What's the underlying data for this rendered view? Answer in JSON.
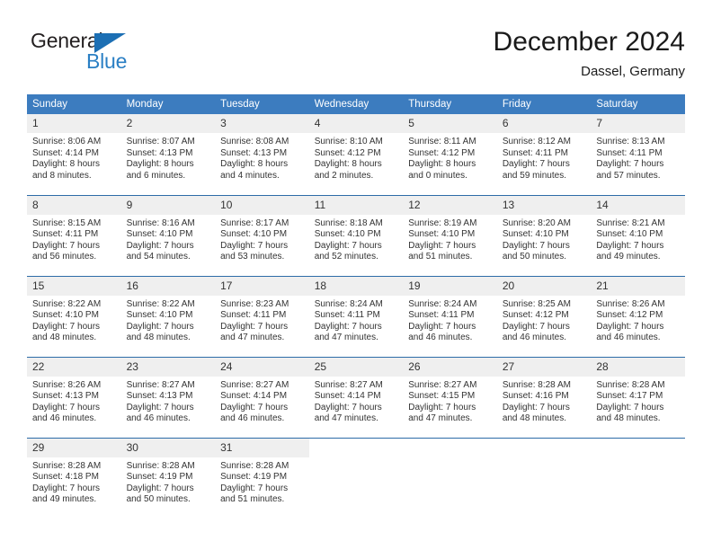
{
  "logo": {
    "word1": "General",
    "word2": "Blue",
    "triangle_color": "#1c6fb4",
    "word2_color": "#2a7fc4"
  },
  "header": {
    "title": "December 2024",
    "subtitle": "Dassel, Germany"
  },
  "theme": {
    "header_blue": "#3c7cbf",
    "row_divider_blue": "#2d6ca8",
    "daynum_band": "#efefef",
    "text": "#333333"
  },
  "calendar": {
    "weekday_headers": [
      "Sunday",
      "Monday",
      "Tuesday",
      "Wednesday",
      "Thursday",
      "Friday",
      "Saturday"
    ],
    "weeks": [
      [
        {
          "day": "1",
          "sunrise": "Sunrise: 8:06 AM",
          "sunset": "Sunset: 4:14 PM",
          "daylight1": "Daylight: 8 hours",
          "daylight2": "and 8 minutes."
        },
        {
          "day": "2",
          "sunrise": "Sunrise: 8:07 AM",
          "sunset": "Sunset: 4:13 PM",
          "daylight1": "Daylight: 8 hours",
          "daylight2": "and 6 minutes."
        },
        {
          "day": "3",
          "sunrise": "Sunrise: 8:08 AM",
          "sunset": "Sunset: 4:13 PM",
          "daylight1": "Daylight: 8 hours",
          "daylight2": "and 4 minutes."
        },
        {
          "day": "4",
          "sunrise": "Sunrise: 8:10 AM",
          "sunset": "Sunset: 4:12 PM",
          "daylight1": "Daylight: 8 hours",
          "daylight2": "and 2 minutes."
        },
        {
          "day": "5",
          "sunrise": "Sunrise: 8:11 AM",
          "sunset": "Sunset: 4:12 PM",
          "daylight1": "Daylight: 8 hours",
          "daylight2": "and 0 minutes."
        },
        {
          "day": "6",
          "sunrise": "Sunrise: 8:12 AM",
          "sunset": "Sunset: 4:11 PM",
          "daylight1": "Daylight: 7 hours",
          "daylight2": "and 59 minutes."
        },
        {
          "day": "7",
          "sunrise": "Sunrise: 8:13 AM",
          "sunset": "Sunset: 4:11 PM",
          "daylight1": "Daylight: 7 hours",
          "daylight2": "and 57 minutes."
        }
      ],
      [
        {
          "day": "8",
          "sunrise": "Sunrise: 8:15 AM",
          "sunset": "Sunset: 4:11 PM",
          "daylight1": "Daylight: 7 hours",
          "daylight2": "and 56 minutes."
        },
        {
          "day": "9",
          "sunrise": "Sunrise: 8:16 AM",
          "sunset": "Sunset: 4:10 PM",
          "daylight1": "Daylight: 7 hours",
          "daylight2": "and 54 minutes."
        },
        {
          "day": "10",
          "sunrise": "Sunrise: 8:17 AM",
          "sunset": "Sunset: 4:10 PM",
          "daylight1": "Daylight: 7 hours",
          "daylight2": "and 53 minutes."
        },
        {
          "day": "11",
          "sunrise": "Sunrise: 8:18 AM",
          "sunset": "Sunset: 4:10 PM",
          "daylight1": "Daylight: 7 hours",
          "daylight2": "and 52 minutes."
        },
        {
          "day": "12",
          "sunrise": "Sunrise: 8:19 AM",
          "sunset": "Sunset: 4:10 PM",
          "daylight1": "Daylight: 7 hours",
          "daylight2": "and 51 minutes."
        },
        {
          "day": "13",
          "sunrise": "Sunrise: 8:20 AM",
          "sunset": "Sunset: 4:10 PM",
          "daylight1": "Daylight: 7 hours",
          "daylight2": "and 50 minutes."
        },
        {
          "day": "14",
          "sunrise": "Sunrise: 8:21 AM",
          "sunset": "Sunset: 4:10 PM",
          "daylight1": "Daylight: 7 hours",
          "daylight2": "and 49 minutes."
        }
      ],
      [
        {
          "day": "15",
          "sunrise": "Sunrise: 8:22 AM",
          "sunset": "Sunset: 4:10 PM",
          "daylight1": "Daylight: 7 hours",
          "daylight2": "and 48 minutes."
        },
        {
          "day": "16",
          "sunrise": "Sunrise: 8:22 AM",
          "sunset": "Sunset: 4:10 PM",
          "daylight1": "Daylight: 7 hours",
          "daylight2": "and 48 minutes."
        },
        {
          "day": "17",
          "sunrise": "Sunrise: 8:23 AM",
          "sunset": "Sunset: 4:11 PM",
          "daylight1": "Daylight: 7 hours",
          "daylight2": "and 47 minutes."
        },
        {
          "day": "18",
          "sunrise": "Sunrise: 8:24 AM",
          "sunset": "Sunset: 4:11 PM",
          "daylight1": "Daylight: 7 hours",
          "daylight2": "and 47 minutes."
        },
        {
          "day": "19",
          "sunrise": "Sunrise: 8:24 AM",
          "sunset": "Sunset: 4:11 PM",
          "daylight1": "Daylight: 7 hours",
          "daylight2": "and 46 minutes."
        },
        {
          "day": "20",
          "sunrise": "Sunrise: 8:25 AM",
          "sunset": "Sunset: 4:12 PM",
          "daylight1": "Daylight: 7 hours",
          "daylight2": "and 46 minutes."
        },
        {
          "day": "21",
          "sunrise": "Sunrise: 8:26 AM",
          "sunset": "Sunset: 4:12 PM",
          "daylight1": "Daylight: 7 hours",
          "daylight2": "and 46 minutes."
        }
      ],
      [
        {
          "day": "22",
          "sunrise": "Sunrise: 8:26 AM",
          "sunset": "Sunset: 4:13 PM",
          "daylight1": "Daylight: 7 hours",
          "daylight2": "and 46 minutes."
        },
        {
          "day": "23",
          "sunrise": "Sunrise: 8:27 AM",
          "sunset": "Sunset: 4:13 PM",
          "daylight1": "Daylight: 7 hours",
          "daylight2": "and 46 minutes."
        },
        {
          "day": "24",
          "sunrise": "Sunrise: 8:27 AM",
          "sunset": "Sunset: 4:14 PM",
          "daylight1": "Daylight: 7 hours",
          "daylight2": "and 46 minutes."
        },
        {
          "day": "25",
          "sunrise": "Sunrise: 8:27 AM",
          "sunset": "Sunset: 4:14 PM",
          "daylight1": "Daylight: 7 hours",
          "daylight2": "and 47 minutes."
        },
        {
          "day": "26",
          "sunrise": "Sunrise: 8:27 AM",
          "sunset": "Sunset: 4:15 PM",
          "daylight1": "Daylight: 7 hours",
          "daylight2": "and 47 minutes."
        },
        {
          "day": "27",
          "sunrise": "Sunrise: 8:28 AM",
          "sunset": "Sunset: 4:16 PM",
          "daylight1": "Daylight: 7 hours",
          "daylight2": "and 48 minutes."
        },
        {
          "day": "28",
          "sunrise": "Sunrise: 8:28 AM",
          "sunset": "Sunset: 4:17 PM",
          "daylight1": "Daylight: 7 hours",
          "daylight2": "and 48 minutes."
        }
      ],
      [
        {
          "day": "29",
          "sunrise": "Sunrise: 8:28 AM",
          "sunset": "Sunset: 4:18 PM",
          "daylight1": "Daylight: 7 hours",
          "daylight2": "and 49 minutes."
        },
        {
          "day": "30",
          "sunrise": "Sunrise: 8:28 AM",
          "sunset": "Sunset: 4:19 PM",
          "daylight1": "Daylight: 7 hours",
          "daylight2": "and 50 minutes."
        },
        {
          "day": "31",
          "sunrise": "Sunrise: 8:28 AM",
          "sunset": "Sunset: 4:19 PM",
          "daylight1": "Daylight: 7 hours",
          "daylight2": "and 51 minutes."
        },
        {
          "day": "",
          "sunrise": "",
          "sunset": "",
          "daylight1": "",
          "daylight2": ""
        },
        {
          "day": "",
          "sunrise": "",
          "sunset": "",
          "daylight1": "",
          "daylight2": ""
        },
        {
          "day": "",
          "sunrise": "",
          "sunset": "",
          "daylight1": "",
          "daylight2": ""
        },
        {
          "day": "",
          "sunrise": "",
          "sunset": "",
          "daylight1": "",
          "daylight2": ""
        }
      ]
    ]
  }
}
